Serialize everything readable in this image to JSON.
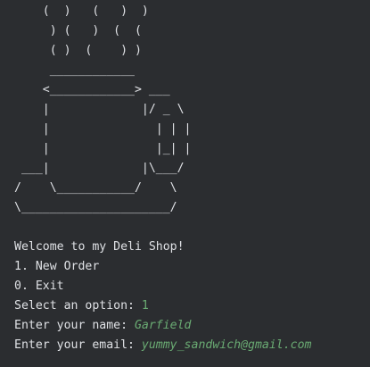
{
  "console": {
    "ascii_art": [
      "    (  )   (   )  )",
      "     ) (   )  (  (",
      "     ( )  (    ) )",
      "     ____________",
      "    <____________> ___",
      "    |             |/ _ \\",
      "    |               | | |",
      "    |               |_| |",
      " ___|             |\\___/",
      "/    \\___________/    \\",
      "\\_____________________/"
    ],
    "welcome": "Welcome to my Deli Shop!",
    "menu": [
      "1. New Order",
      "0. Exit"
    ],
    "option_prompt": "Select an option: ",
    "option_value": "1",
    "name_prompt": "Enter your name: ",
    "name_value": "Garfield",
    "email_prompt": "Enter your email: ",
    "email_value": "yummy_sandwich@gmail.com"
  },
  "colors": {
    "background": "#2b2d30",
    "text": "#dfe1e5",
    "user_input": "#6aab73"
  }
}
